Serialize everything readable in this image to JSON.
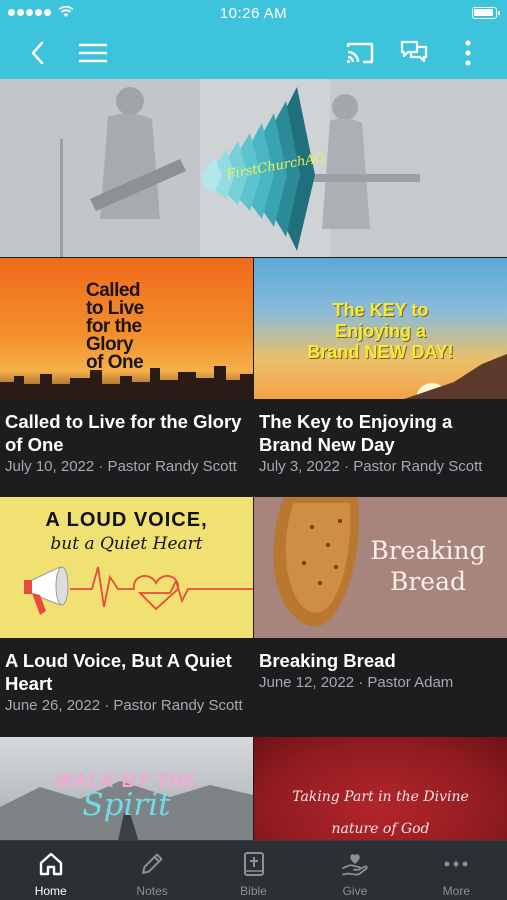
{
  "status_bar": {
    "time": "10:26 AM"
  },
  "toolbar": {
    "back_icon": "chevron-left-icon",
    "menu_icon": "hamburger-menu-icon",
    "cast_icon": "cast-icon",
    "chat_icon": "chat-icon",
    "more_icon": "more-vertical-icon"
  },
  "hero": {
    "logo_text": "FirstChurchAG"
  },
  "sermons": [
    {
      "title": "Called to Live for the Glory of One",
      "meta": "July 10, 2022 · Pastor Randy Scott",
      "art_text": [
        "Called",
        "to Live",
        "for the",
        "Glory",
        "of One"
      ]
    },
    {
      "title": "The Key to Enjoying a Brand New Day",
      "meta": "July 3, 2022 · Pastor Randy Scott",
      "art_text": [
        "The KEY to",
        "Enjoying a",
        "Brand NEW DAY!"
      ]
    },
    {
      "title": "A Loud Voice, But A Quiet Heart",
      "meta": "June 26, 2022 · Pastor Randy Scott",
      "art_text": [
        "A LOUD VOICE,",
        "but a Quiet Heart"
      ]
    },
    {
      "title": "Breaking Bread",
      "meta": "June 12, 2022 · Pastor Adam",
      "art_text": [
        "Breaking",
        "Bread"
      ]
    },
    {
      "title": "",
      "meta": "",
      "art_text": [
        "WALK BY THE",
        "Spirit"
      ]
    },
    {
      "title": "",
      "meta": "",
      "art_text": [
        "Taking Part in the Divine",
        "nature of God"
      ]
    }
  ],
  "bottom_nav": [
    {
      "label": "Home",
      "icon": "home-icon",
      "active": true
    },
    {
      "label": "Notes",
      "icon": "pencil-icon",
      "active": false
    },
    {
      "label": "Bible",
      "icon": "bible-icon",
      "active": false
    },
    {
      "label": "Give",
      "icon": "give-hand-heart-icon",
      "active": false
    },
    {
      "label": "More",
      "icon": "more-horizontal-icon",
      "active": false
    }
  ],
  "colors": {
    "accent": "#3ec3dd",
    "background": "#1b1d1f",
    "nav_background": "#2c2f33",
    "meta_text": "#a6a9ad"
  }
}
